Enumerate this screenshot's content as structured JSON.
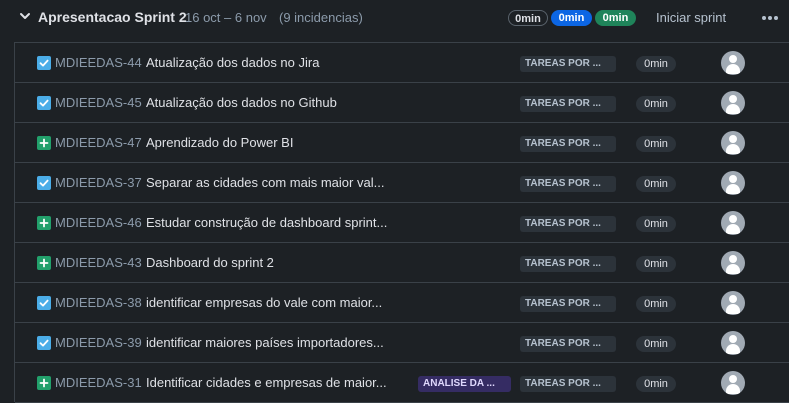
{
  "sprint": {
    "name": "Apresentacao Sprint 2",
    "dates": "16 oct – 6 nov",
    "count": "(9 incidencias)",
    "estimates": {
      "todo": "0min",
      "in_progress": "0min",
      "done": "0min"
    },
    "start_label": "Iniciar sprint"
  },
  "colors": {
    "task": "#4bade8",
    "story": "#22a06b",
    "progress_pill": "#0c66e4",
    "done_pill": "#1f845a",
    "epic": "#352c63"
  },
  "issues": [
    {
      "type": "task",
      "key": "MDIEEDAS-44",
      "summary": "Atualização dos dados no Jira",
      "epic": "",
      "status": "TAREAS POR ...",
      "estimate": "0min"
    },
    {
      "type": "task",
      "key": "MDIEEDAS-45",
      "summary": "Atualização dos dados no Github",
      "epic": "",
      "status": "TAREAS POR ...",
      "estimate": "0min"
    },
    {
      "type": "story",
      "key": "MDIEEDAS-47",
      "summary": "Aprendizado do Power BI",
      "epic": "",
      "status": "TAREAS POR ...",
      "estimate": "0min"
    },
    {
      "type": "task",
      "key": "MDIEEDAS-37",
      "summary": "Separar as cidades com mais maior val...",
      "epic": "",
      "status": "TAREAS POR ...",
      "estimate": "0min"
    },
    {
      "type": "story",
      "key": "MDIEEDAS-46",
      "summary": "Estudar construção de dashboard sprint...",
      "epic": "",
      "status": "TAREAS POR ...",
      "estimate": "0min"
    },
    {
      "type": "story",
      "key": "MDIEEDAS-43",
      "summary": "Dashboard do sprint 2",
      "epic": "",
      "status": "TAREAS POR ...",
      "estimate": "0min"
    },
    {
      "type": "task",
      "key": "MDIEEDAS-38",
      "summary": "identificar empresas do vale com maior...",
      "epic": "",
      "status": "TAREAS POR ...",
      "estimate": "0min"
    },
    {
      "type": "task",
      "key": "MDIEEDAS-39",
      "summary": "identificar maiores países importadores...",
      "epic": "",
      "status": "TAREAS POR ...",
      "estimate": "0min"
    },
    {
      "type": "story",
      "key": "MDIEEDAS-31",
      "summary": "Identificar cidades e empresas de maior...",
      "epic": "ANALISE DA ...",
      "status": "TAREAS POR ...",
      "estimate": "0min"
    }
  ]
}
